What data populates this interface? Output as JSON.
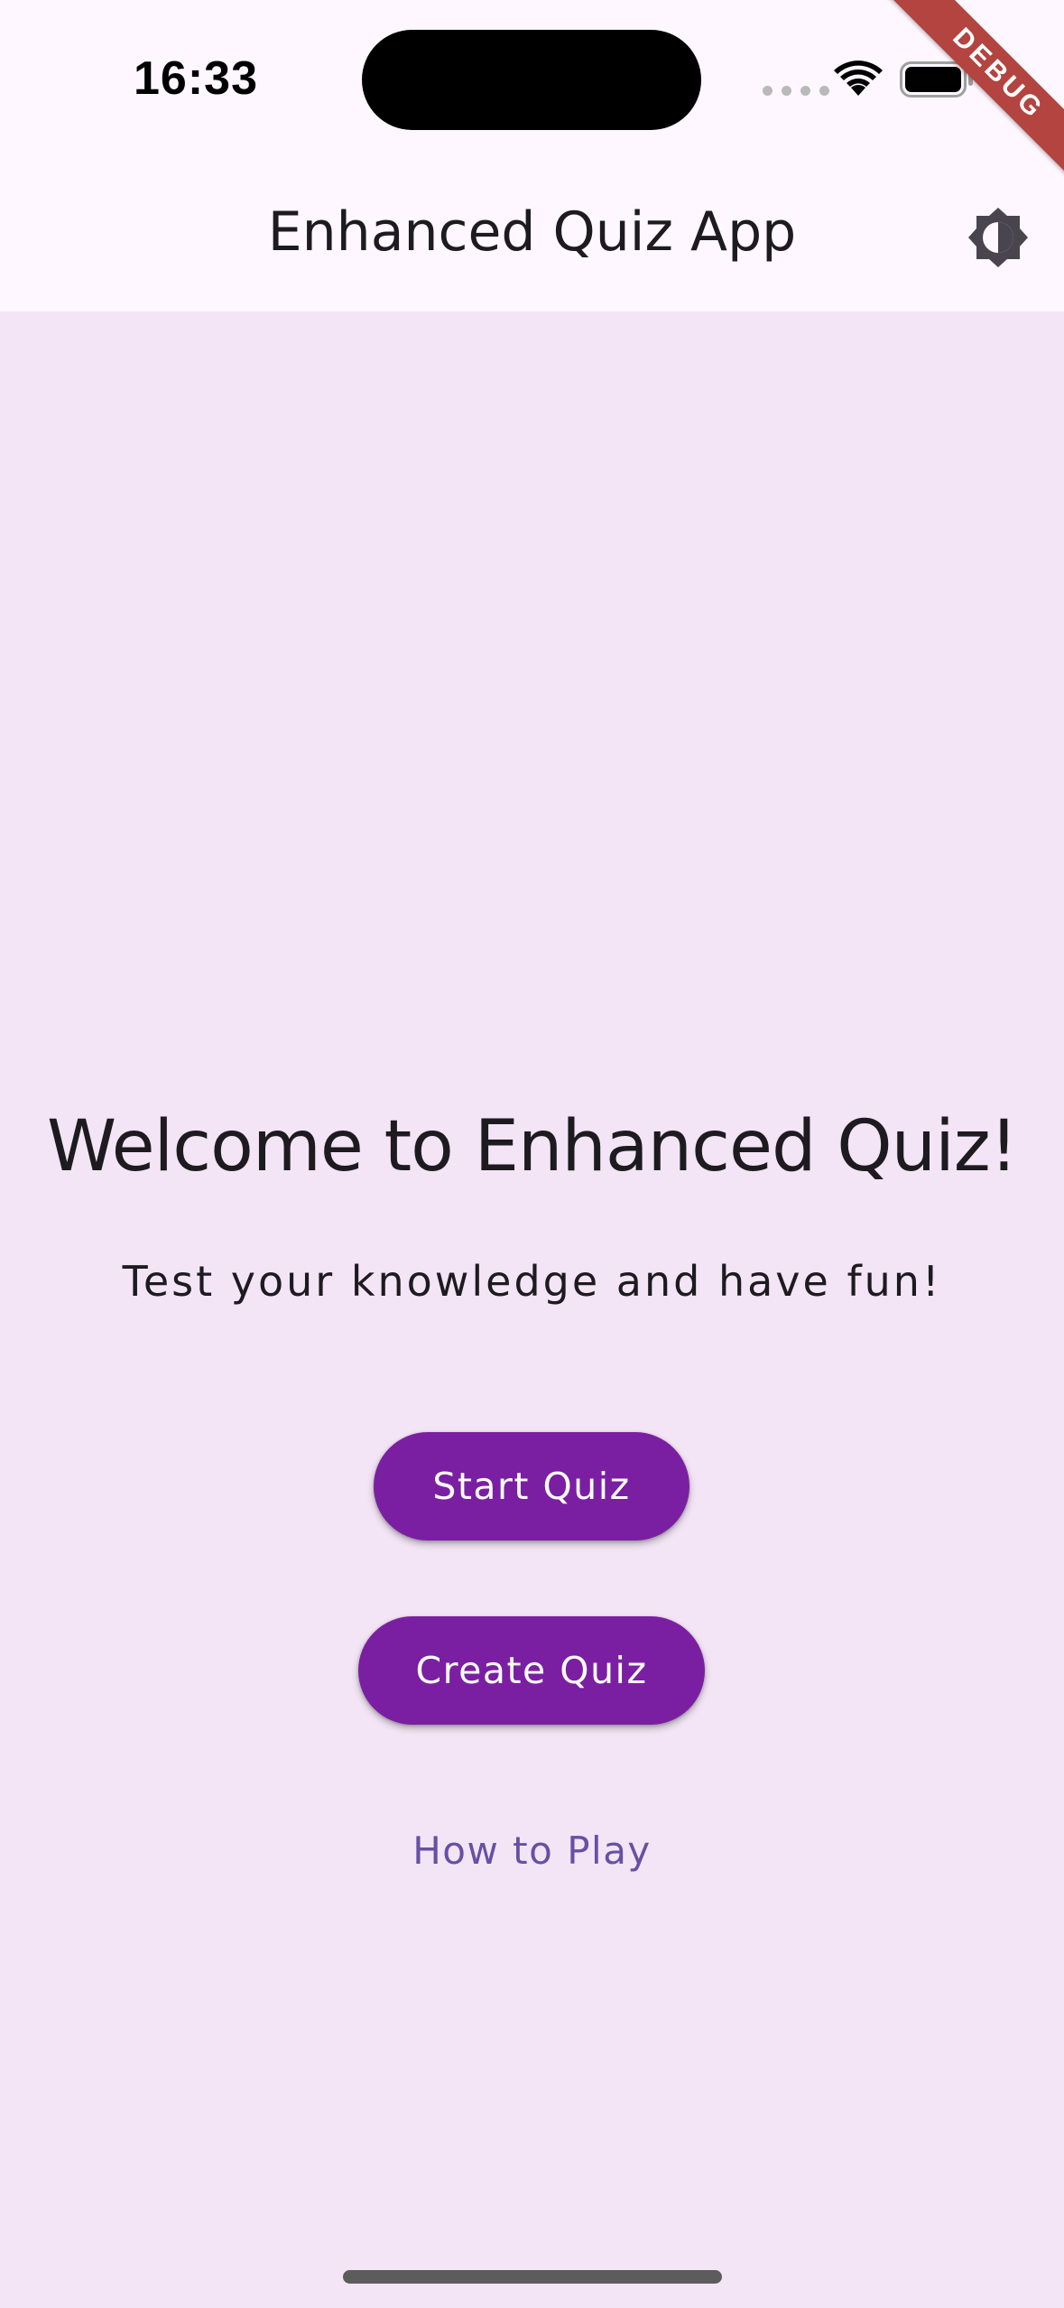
{
  "status_bar": {
    "time": "16:33",
    "icons": [
      "cellular-dots-icon",
      "wifi-icon",
      "battery-icon"
    ]
  },
  "debug_banner": {
    "label": "DEBUG",
    "color": "#b3443f"
  },
  "app_bar": {
    "title": "Enhanced Quiz App",
    "action_icon": "brightness-toggle-icon",
    "background": "#fef7ff"
  },
  "main": {
    "title": "Welcome to Enhanced Quiz!",
    "subtitle": "Test your knowledge and have fun!",
    "primary_button": "Start Quiz",
    "secondary_button": "Create Quiz",
    "text_link": "How to Play",
    "background": "#f3e5f5"
  },
  "colors": {
    "button": "#7b1fa2",
    "button_text": "#ffffff",
    "link": "#6750a4",
    "text": "#1d1b20"
  }
}
